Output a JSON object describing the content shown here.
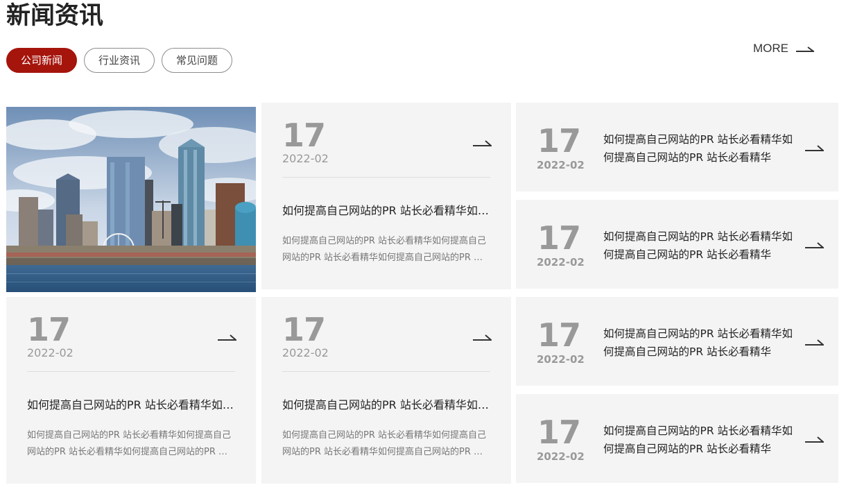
{
  "section": {
    "title": "新闻资讯",
    "more_label": "MORE",
    "tabs": [
      {
        "label": "公司新闻",
        "active": true
      },
      {
        "label": "行业资讯",
        "active": false
      },
      {
        "label": "常见问题",
        "active": false
      }
    ]
  },
  "colors": {
    "accent": "#a5150c",
    "card_bg": "#f4f4f4",
    "date_gray": "#999999"
  },
  "feature_image": {
    "icon": "city-skyline-photo"
  },
  "big_cards": [
    {
      "day": "17",
      "year_month": "2022-02",
      "headline": "如何提高自己网站的PR 站长必看精华如何提高自己网站的PR 站长必看精华",
      "summary": "如何提高自己网站的PR 站长必看精华如何提高自己网站的PR 站长必看精华如何提高自己网站的PR 站长必看精华"
    },
    {
      "day": "17",
      "year_month": "2022-02",
      "headline": "如何提高自己网站的PR 站长必看精华如何提高自己网站的PR 站长必看精华",
      "summary": "如何提高自己网站的PR 站长必看精华如何提高自己网站的PR 站长必看精华如何提高自己网站的PR 站长必看精华"
    },
    {
      "day": "17",
      "year_month": "2022-02",
      "headline": "如何提高自己网站的PR 站长必看精华如何提高自己网站的PR 站长必看精华",
      "summary": "如何提高自己网站的PR 站长必看精华如何提高自己网站的PR 站长必看精华如何提高自己网站的PR 站长必看精华"
    }
  ],
  "small_cards": [
    {
      "day": "17",
      "year_month": "2022-02",
      "headline": "如何提高自己网站的PR 站长必看精华如何提高自己网站的PR 站长必看精华"
    },
    {
      "day": "17",
      "year_month": "2022-02",
      "headline": "如何提高自己网站的PR 站长必看精华如何提高自己网站的PR 站长必看精华"
    },
    {
      "day": "17",
      "year_month": "2022-02",
      "headline": "如何提高自己网站的PR 站长必看精华如何提高自己网站的PR 站长必看精华"
    },
    {
      "day": "17",
      "year_month": "2022-02",
      "headline": "如何提高自己网站的PR 站长必看精华如何提高自己网站的PR 站长必看精华"
    }
  ]
}
